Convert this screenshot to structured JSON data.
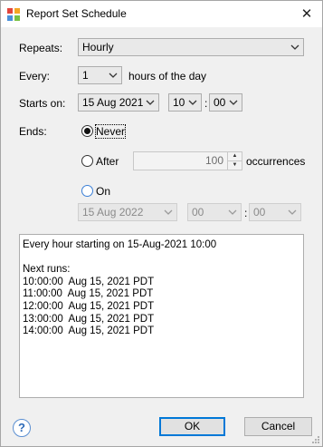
{
  "window": {
    "title": "Report Set Schedule",
    "close_glyph": "✕",
    "icon": "app-logo-icon"
  },
  "repeats": {
    "label": "Repeats:",
    "value": "Hourly"
  },
  "every": {
    "label": "Every:",
    "value": "1",
    "suffix": "hours of the day"
  },
  "starts_on": {
    "label": "Starts on:",
    "date": "15 Aug 2021",
    "hour": "10",
    "minute": "00",
    "separator": ":"
  },
  "ends": {
    "label": "Ends:",
    "never_label": "Never",
    "never_checked": true,
    "after_label": "After",
    "after_value": "100",
    "after_suffix": "occurrences",
    "on_label": "On",
    "on_date": "15 Aug 2022",
    "on_hour": "00",
    "on_minute": "00",
    "separator": ":"
  },
  "summary": {
    "description": "Every hour starting on 15-Aug-2021 10:00",
    "next_runs_label": "Next runs:",
    "runs": [
      "10:00:00  Aug 15, 2021 PDT",
      "11:00:00  Aug 15, 2021 PDT",
      "12:00:00  Aug 15, 2021 PDT",
      "13:00:00  Aug 15, 2021 PDT",
      "14:00:00  Aug 15, 2021 PDT"
    ]
  },
  "footer": {
    "help_glyph": "?",
    "ok_label": "OK",
    "cancel_label": "Cancel"
  },
  "colors": {
    "accent": "#0078d7",
    "dialog_bg": "#f0f0f0",
    "help_blue": "#2d6ab8"
  }
}
